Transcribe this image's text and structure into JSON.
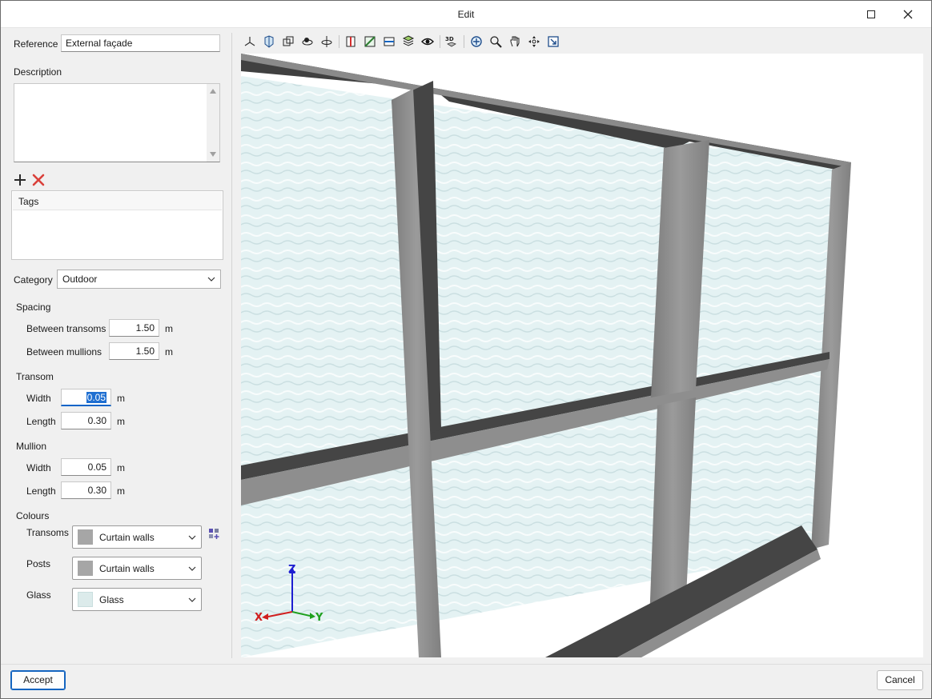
{
  "window": {
    "title": "Edit"
  },
  "form": {
    "reference_label": "Reference",
    "reference_value": "External façade",
    "description_label": "Description",
    "description_value": "",
    "tags_header": "Tags",
    "category_label": "Category",
    "category_value": "Outdoor",
    "spacing": {
      "heading": "Spacing",
      "between_transoms_label": "Between transoms",
      "between_transoms_value": "1.50",
      "between_mullions_label": "Between mullions",
      "between_mullions_value": "1.50",
      "unit": "m"
    },
    "transom": {
      "heading": "Transom",
      "width_label": "Width",
      "width_value": "0.05",
      "length_label": "Length",
      "length_value": "0.30",
      "unit": "m"
    },
    "mullion": {
      "heading": "Mullion",
      "width_label": "Width",
      "width_value": "0.05",
      "length_label": "Length",
      "length_value": "0.30",
      "unit": "m"
    },
    "colours": {
      "heading": "Colours",
      "transoms_label": "Transoms",
      "transoms_value": "Curtain walls",
      "transoms_swatch": "#a6a6a6",
      "posts_label": "Posts",
      "posts_value": "Curtain walls",
      "posts_swatch": "#a6a6a6",
      "glass_label": "Glass",
      "glass_value": "Glass",
      "glass_swatch": "#dcebeb"
    }
  },
  "toolbar": {
    "icons": [
      "axes-icon",
      "shaded-view-icon",
      "wireframe-view-icon",
      "orbit-icon",
      "rotate-axis-icon",
      "section-x-icon",
      "section-y-icon",
      "section-z-icon",
      "layers-icon",
      "visibility-eye-icon",
      "3d-view-icon",
      "zoom-all-icon",
      "zoom-window-icon",
      "pan-hand-icon",
      "move-icon",
      "export-view-icon"
    ],
    "view3d_label": "3D"
  },
  "viewport": {
    "axes": {
      "x": "X",
      "y": "Y",
      "z": "Z"
    },
    "colors": {
      "frame": "#858585",
      "frame_dark": "#3f3f3f",
      "glass": "#e4f2f3"
    }
  },
  "buttons": {
    "accept": "Accept",
    "cancel": "Cancel"
  }
}
